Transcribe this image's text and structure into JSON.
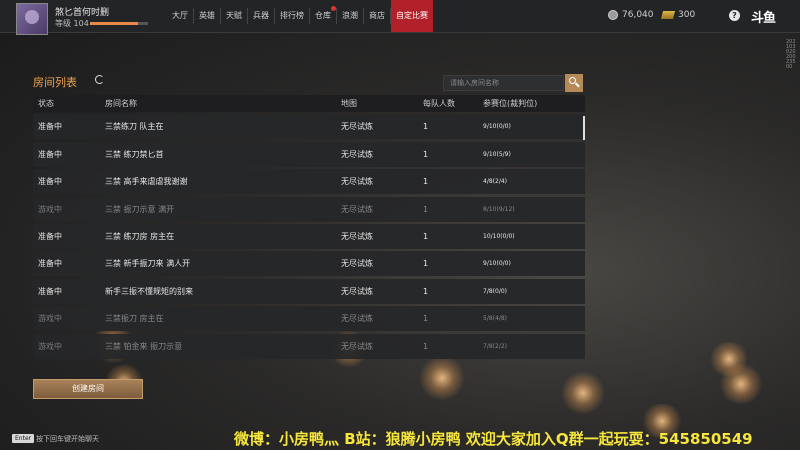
{
  "player": {
    "name": "煞匕首何时删",
    "level_label": "等级 104",
    "exp_progress": 0.82
  },
  "nav": {
    "items": [
      {
        "label": "大厅",
        "active": false
      },
      {
        "label": "英雄",
        "active": false
      },
      {
        "label": "天赋",
        "active": false
      },
      {
        "label": "兵器",
        "active": false
      },
      {
        "label": "排行榜",
        "active": false
      },
      {
        "label": "仓库",
        "active": false,
        "dot": true
      },
      {
        "label": "浪潮",
        "active": false
      },
      {
        "label": "商店",
        "active": false
      },
      {
        "label": "自定比赛",
        "active": true
      }
    ]
  },
  "currency": {
    "coins": "76,040",
    "gold": "300"
  },
  "icons": {
    "coin": "coin-icon",
    "gold": "gold-bar-icon",
    "help": "help-icon",
    "refresh": "refresh-icon",
    "search": "search-icon"
  },
  "logo": {
    "text": "斗鱼"
  },
  "side_code": "20210302020023500",
  "room_list": {
    "title": "房间列表",
    "search_placeholder": "请输入房间名称",
    "columns": {
      "state": "状态",
      "name": "房间名称",
      "map": "地图",
      "team": "每队人数",
      "seats": "参赛位(裁判位)"
    },
    "rows": [
      {
        "state": "准备中",
        "name": "三禁练刀 队主在",
        "map": "无尽试炼",
        "team": "1",
        "seats": "9/10(0/0)",
        "in_game": false
      },
      {
        "state": "准备中",
        "name": "三禁   练刀禁匕首",
        "map": "无尽试炼",
        "team": "1",
        "seats": "9/10(5/9)",
        "in_game": false
      },
      {
        "state": "准备中",
        "name": "三禁 高手来虐虐我谢谢",
        "map": "无尽试炼",
        "team": "1",
        "seats": "4/8(2/4)",
        "in_game": false
      },
      {
        "state": "游戏中",
        "name": "三禁  振刀示意  满开",
        "map": "无尽试炼",
        "team": "1",
        "seats": "8/10(9/12)",
        "in_game": true
      },
      {
        "state": "准备中",
        "name": "三禁 练刀房 房主在",
        "map": "无尽试炼",
        "team": "1",
        "seats": "10/10(0/0)",
        "in_game": false
      },
      {
        "state": "准备中",
        "name": "三禁 新手振刀来  满人开",
        "map": "无尽试炼",
        "team": "1",
        "seats": "9/10(0/0)",
        "in_game": false
      },
      {
        "state": "准备中",
        "name": "新手三振不懂规矩的别来",
        "map": "无尽试炼",
        "team": "1",
        "seats": "7/8(0/0)",
        "in_game": false
      },
      {
        "state": "游戏中",
        "name": "三禁振刀 房主在",
        "map": "无尽试炼",
        "team": "1",
        "seats": "5/8(4/8)",
        "in_game": true
      },
      {
        "state": "游戏中",
        "name": "三禁 铂金来 振刀示意",
        "map": "无尽试炼",
        "team": "1",
        "seats": "7/8(2/2)",
        "in_game": true
      }
    ]
  },
  "create_room_label": "创建房间",
  "chat": {
    "key_label": "Enter",
    "hint": "按下回车键开始聊天"
  },
  "banner": "微博：小房鸭灬 B站：狼腾小房鸭 欢迎大家加入Q群一起玩耍：545850549"
}
